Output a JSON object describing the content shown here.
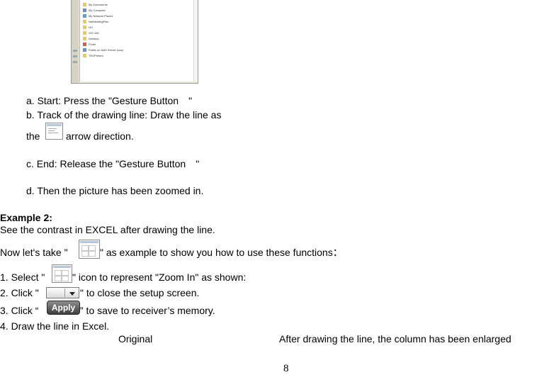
{
  "screenshot": {
    "tree_items": [
      "My Documents",
      "My Computer",
      "My Network Places",
      "NetMeetingPlan",
      "DH",
      "GIS 280",
      "Desktop",
      "Fonts",
      "Public on NAS Server (nas)",
      "TEOPrblem"
    ]
  },
  "steps": {
    "a": "a. Start: Press the \"Gesture Button　\"",
    "b": "b. Track of the drawing line: Draw the line as",
    "b_the": "the",
    "b_after": "arrow direction.",
    "c": "c. End: Release the \"Gesture Button　\"",
    "d": "d. Then the picture has been zoomed in."
  },
  "example": {
    "heading": "Example 2:",
    "intro": "See the contrast in EXCEL after drawing the line.",
    "now_pre": "Now let's take \"",
    "now_post": "\" as example to show you how to use these functions：",
    "item1_pre": "1. Select \"",
    "item1_post": "\" icon to represent \"Zoom In\" as shown:",
    "item2_pre": "2. Click \"",
    "item2_post": "\" to close the setup screen.",
    "item3_pre": "3. Click “",
    "item3_post": "” to save to receiver’s memory.",
    "apply_label": "Apply",
    "item4": "4. Draw the line in Excel."
  },
  "captions": {
    "original": "Original",
    "after": "After drawing the line, the column has been enlarged"
  },
  "page_number": "8"
}
